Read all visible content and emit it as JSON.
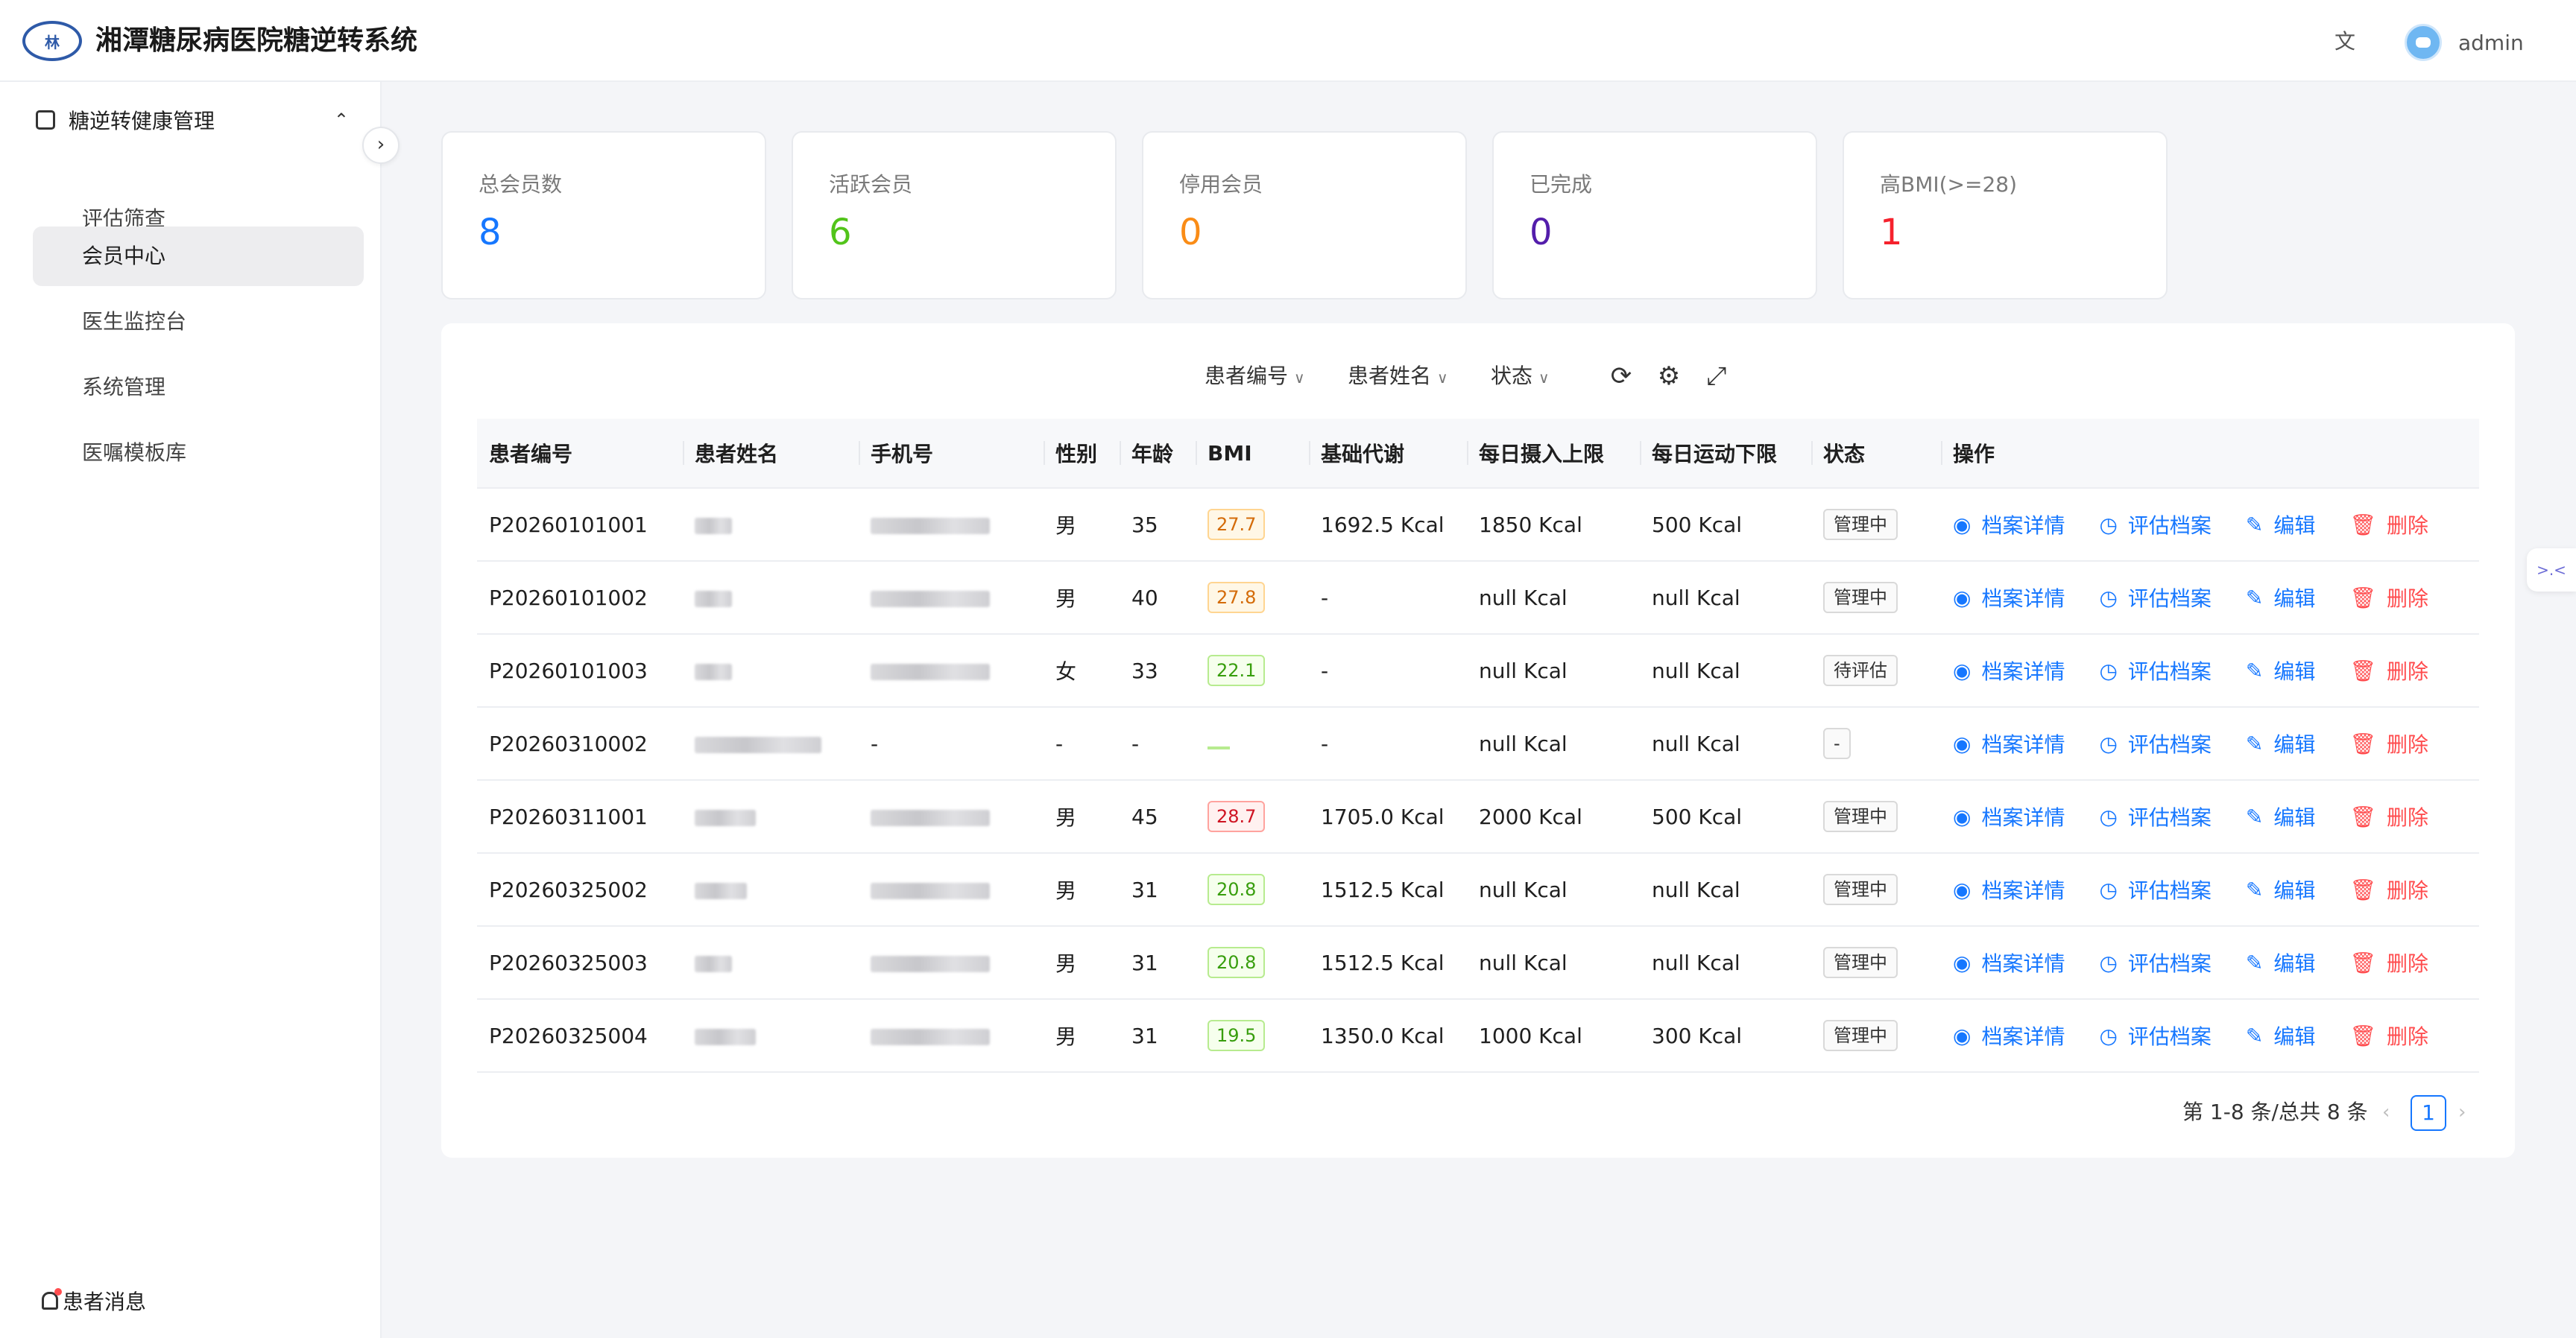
{
  "header": {
    "logo_text": "林",
    "title": "湘潭糖尿病医院糖逆转系统",
    "translate_icon": "translate-icon",
    "username": "admin"
  },
  "sidebar": {
    "group_label": "糖逆转健康管理",
    "items": [
      {
        "label": "评估筛查",
        "active": false
      },
      {
        "label": "会员中心",
        "active": true
      },
      {
        "label": "医生监控台",
        "active": false
      },
      {
        "label": "系统管理",
        "active": false
      },
      {
        "label": "医嘱模板库",
        "active": false
      }
    ],
    "notification_label": "患者消息"
  },
  "stats": [
    {
      "label": "总会员数",
      "value": "8",
      "color": "#1677ff"
    },
    {
      "label": "活跃会员",
      "value": "6",
      "color": "#52c41a"
    },
    {
      "label": "停用会员",
      "value": "0",
      "color": "#fa8c16"
    },
    {
      "label": "已完成",
      "value": "0",
      "color": "#531dab"
    },
    {
      "label": "高BMI(>=28)",
      "value": "1",
      "color": "#f5222d"
    }
  ],
  "filters": {
    "patient_id": "患者编号",
    "patient_name": "患者姓名",
    "status": "状态"
  },
  "table": {
    "columns": [
      "患者编号",
      "患者姓名",
      "手机号",
      "性别",
      "年龄",
      "BMI",
      "基础代谢",
      "每日摄入上限",
      "每日运动下限",
      "状态",
      "操作"
    ],
    "actions": {
      "view": "档案详情",
      "assess": "评估档案",
      "edit": "编辑",
      "delete": "删除"
    },
    "rows": [
      {
        "id": "P20260101001",
        "phone": "",
        "gender": "男",
        "age": "35",
        "bmi": "27.7",
        "bmi_level": "warn",
        "bmr": "1692.5 Kcal",
        "intake": "1850 Kcal",
        "exercise": "500 Kcal",
        "status": "管理中"
      },
      {
        "id": "P20260101002",
        "phone": "",
        "gender": "男",
        "age": "40",
        "bmi": "27.8",
        "bmi_level": "warn",
        "bmr": "-",
        "intake": "null Kcal",
        "exercise": "null Kcal",
        "status": "管理中"
      },
      {
        "id": "P20260101003",
        "phone": "",
        "gender": "女",
        "age": "33",
        "bmi": "22.1",
        "bmi_level": "ok",
        "bmr": "-",
        "intake": "null Kcal",
        "exercise": "null Kcal",
        "status": "待评估"
      },
      {
        "id": "P20260310002",
        "phone": "-",
        "gender": "-",
        "age": "-",
        "bmi": "",
        "bmi_level": "empty",
        "bmr": "-",
        "intake": "null Kcal",
        "exercise": "null Kcal",
        "status": "-"
      },
      {
        "id": "P20260311001",
        "phone": "",
        "gender": "男",
        "age": "45",
        "bmi": "28.7",
        "bmi_level": "bad",
        "bmr": "1705.0 Kcal",
        "intake": "2000 Kcal",
        "exercise": "500 Kcal",
        "status": "管理中"
      },
      {
        "id": "P20260325002",
        "phone": "",
        "gender": "男",
        "age": "31",
        "bmi": "20.8",
        "bmi_level": "ok",
        "bmr": "1512.5 Kcal",
        "intake": "null Kcal",
        "exercise": "null Kcal",
        "status": "管理中"
      },
      {
        "id": "P20260325003",
        "phone": "",
        "gender": "男",
        "age": "31",
        "bmi": "20.8",
        "bmi_level": "ok",
        "bmr": "1512.5 Kcal",
        "intake": "null Kcal",
        "exercise": "null Kcal",
        "status": "管理中"
      },
      {
        "id": "P20260325004",
        "phone": "",
        "gender": "男",
        "age": "31",
        "bmi": "19.5",
        "bmi_level": "ok",
        "bmr": "1350.0 Kcal",
        "intake": "1000 Kcal",
        "exercise": "300 Kcal",
        "status": "管理中"
      }
    ]
  },
  "pagination": {
    "summary": "第 1-8 条/总共 8 条",
    "current_page": "1"
  }
}
